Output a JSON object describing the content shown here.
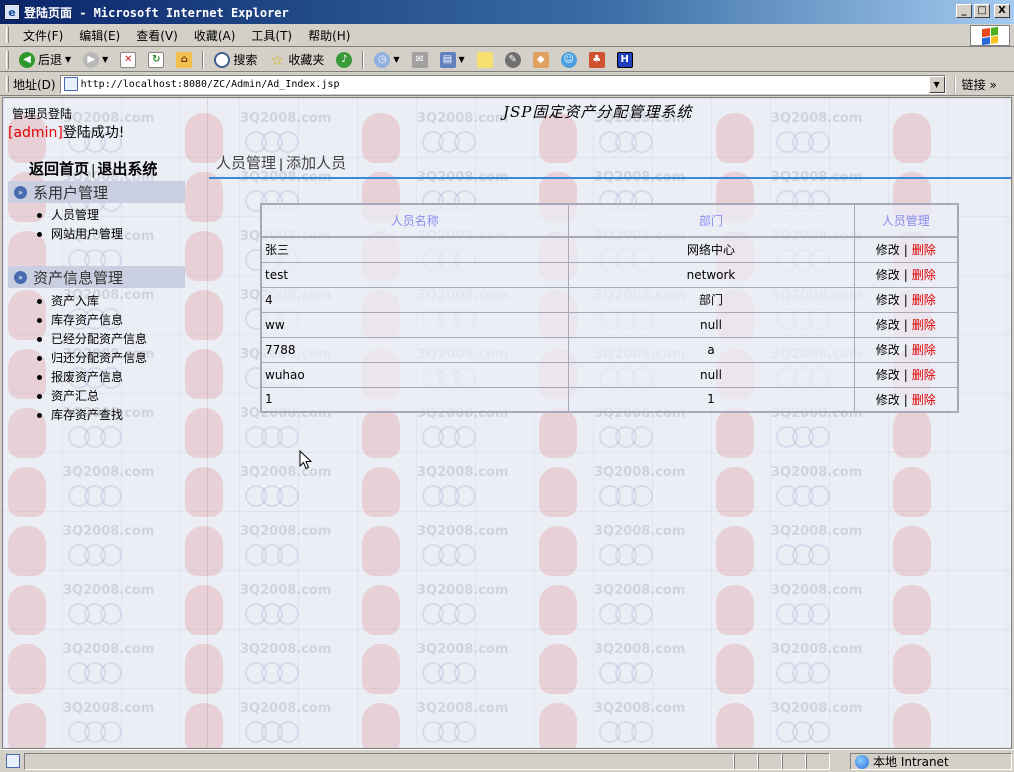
{
  "window": {
    "title": "登陆页面 - Microsoft Internet Explorer",
    "minimize": "_",
    "maximize": "□",
    "close": "X"
  },
  "menu": [
    "文件(F)",
    "编辑(E)",
    "查看(V)",
    "收藏(A)",
    "工具(T)",
    "帮助(H)"
  ],
  "toolbar": {
    "back": "后退",
    "search": "搜索",
    "favorites": "收藏夹"
  },
  "address": {
    "label": "地址(D)",
    "url": "http://localhost:8080/ZC/Admin/Ad_Index.jsp",
    "links": "链接"
  },
  "page": {
    "admin_title": "管理员登陆",
    "site_title": "JSP固定资产分配管理系统",
    "login_user": "[admin]",
    "login_msg": "登陆成功!",
    "top_links": [
      "返回首页",
      "|",
      "退出系统"
    ],
    "sidebar": [
      {
        "title": "系用户管理",
        "items": [
          "人员管理",
          "网站用户管理"
        ]
      },
      {
        "title": "资产信息管理",
        "items": [
          "资产入库",
          "库存资产信息",
          "已经分配资产信息",
          "归还分配资产信息",
          "报废资产信息",
          "资产汇总",
          "库存资产查找"
        ]
      }
    ],
    "tabs": [
      "人员管理",
      "|",
      "添加人员"
    ],
    "table": {
      "headers": [
        "人员名称",
        "部门",
        "人员管理"
      ],
      "rows": [
        {
          "name": "张三",
          "dept": "网络中心"
        },
        {
          "name": "test",
          "dept": "network"
        },
        {
          "name": "4",
          "dept": "部门"
        },
        {
          "name": "ww",
          "dept": "null"
        },
        {
          "name": "7788",
          "dept": "a"
        },
        {
          "name": "wuhao",
          "dept": "null"
        },
        {
          "name": "1",
          "dept": "1"
        }
      ],
      "edit_label": "修改",
      "sep": "|",
      "delete_label": "删除"
    },
    "watermark": "3Q2008.com"
  },
  "status": {
    "zone": "本地 Intranet"
  }
}
